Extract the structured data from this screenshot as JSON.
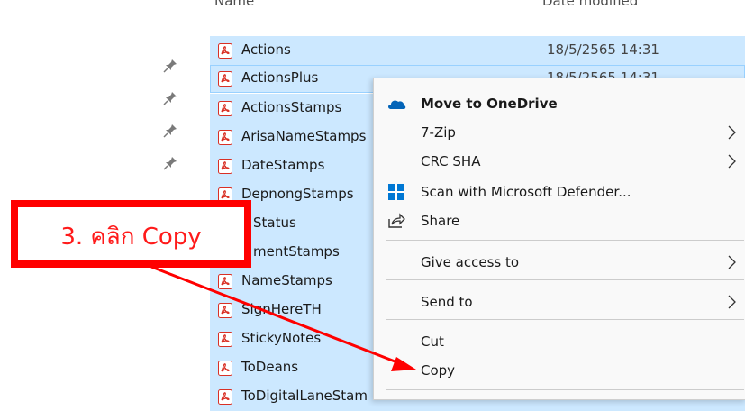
{
  "header": {
    "col_name": "Name",
    "col_date": "Date modified"
  },
  "quick_access_pins": {
    "icon": "pin-icon",
    "count": 4
  },
  "files": [
    {
      "name": "Actions",
      "date": "18/5/2565 14:31"
    },
    {
      "name": "ActionsPlus",
      "date": "18/5/2565 14:31"
    },
    {
      "name": "ActionsStamps",
      "date": ""
    },
    {
      "name": "ArisaNameStamps",
      "date": ""
    },
    {
      "name": "DateStamps",
      "date": ""
    },
    {
      "name": "DepnongStamps",
      "date": ""
    },
    {
      "name": "Status",
      "date": ""
    },
    {
      "name": "mentStamps",
      "date": ""
    },
    {
      "name": "NameStamps",
      "date": ""
    },
    {
      "name": "SignHereTH",
      "date": ""
    },
    {
      "name": "StickyNotes",
      "date": ""
    },
    {
      "name": "ToDeans",
      "date": ""
    },
    {
      "name": "ToDigitalLaneStam",
      "date": ""
    }
  ],
  "file_icon": "pdf-icon",
  "context_menu": {
    "items": [
      {
        "label": "Move to OneDrive",
        "icon": "onedrive-cloud-icon",
        "bold": true
      },
      {
        "label": "7-Zip",
        "submenu": true
      },
      {
        "label": "CRC SHA",
        "submenu": true
      },
      {
        "label": "Scan with Microsoft Defender...",
        "icon": "defender-shield-icon"
      },
      {
        "label": "Share",
        "icon": "share-icon"
      },
      {
        "label": "Give access to",
        "submenu": true
      },
      {
        "label": "Send to",
        "submenu": true
      },
      {
        "label": "Cut"
      },
      {
        "label": "Copy"
      }
    ]
  },
  "annotation": {
    "text": "3. คลิก Copy"
  },
  "colors": {
    "selection": "#cce8ff",
    "annotation_red": "#ff0000",
    "onedrive_blue": "#0364b8",
    "defender_blue": "#0078d4"
  }
}
